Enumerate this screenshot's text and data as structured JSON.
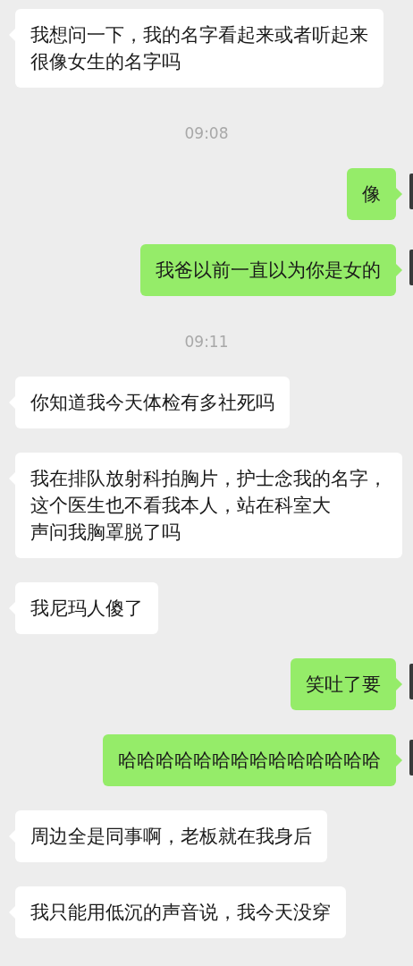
{
  "messages": [
    {
      "kind": "incoming",
      "lines": [
        "我想问一下，我的名字看起来或者听起来",
        "很像女生的名字吗"
      ]
    },
    {
      "kind": "time",
      "lines": [
        "09:08"
      ]
    },
    {
      "kind": "outgoing",
      "lines": [
        "像"
      ]
    },
    {
      "kind": "outgoing",
      "lines": [
        "我爸以前一直以为你是女的"
      ]
    },
    {
      "kind": "time",
      "lines": [
        "09:11"
      ]
    },
    {
      "kind": "incoming",
      "lines": [
        "你知道我今天体检有多社死吗"
      ]
    },
    {
      "kind": "incoming",
      "lines": [
        "我在排队放射科拍胸片，护士念我的名字，",
        "这个医生也不看我本人，站在科室大",
        "声问我胸罩脱了吗"
      ]
    },
    {
      "kind": "incoming",
      "lines": [
        "我尼玛人傻了"
      ]
    },
    {
      "kind": "outgoing",
      "lines": [
        "笑吐了要"
      ]
    },
    {
      "kind": "outgoing",
      "lines": [
        "哈哈哈哈哈哈哈哈哈哈哈哈哈哈"
      ]
    },
    {
      "kind": "incoming",
      "lines": [
        "周边全是同事啊，老板就在我身后"
      ]
    },
    {
      "kind": "incoming",
      "lines": [
        "我只能用低沉的声音说，我今天没穿"
      ]
    }
  ]
}
